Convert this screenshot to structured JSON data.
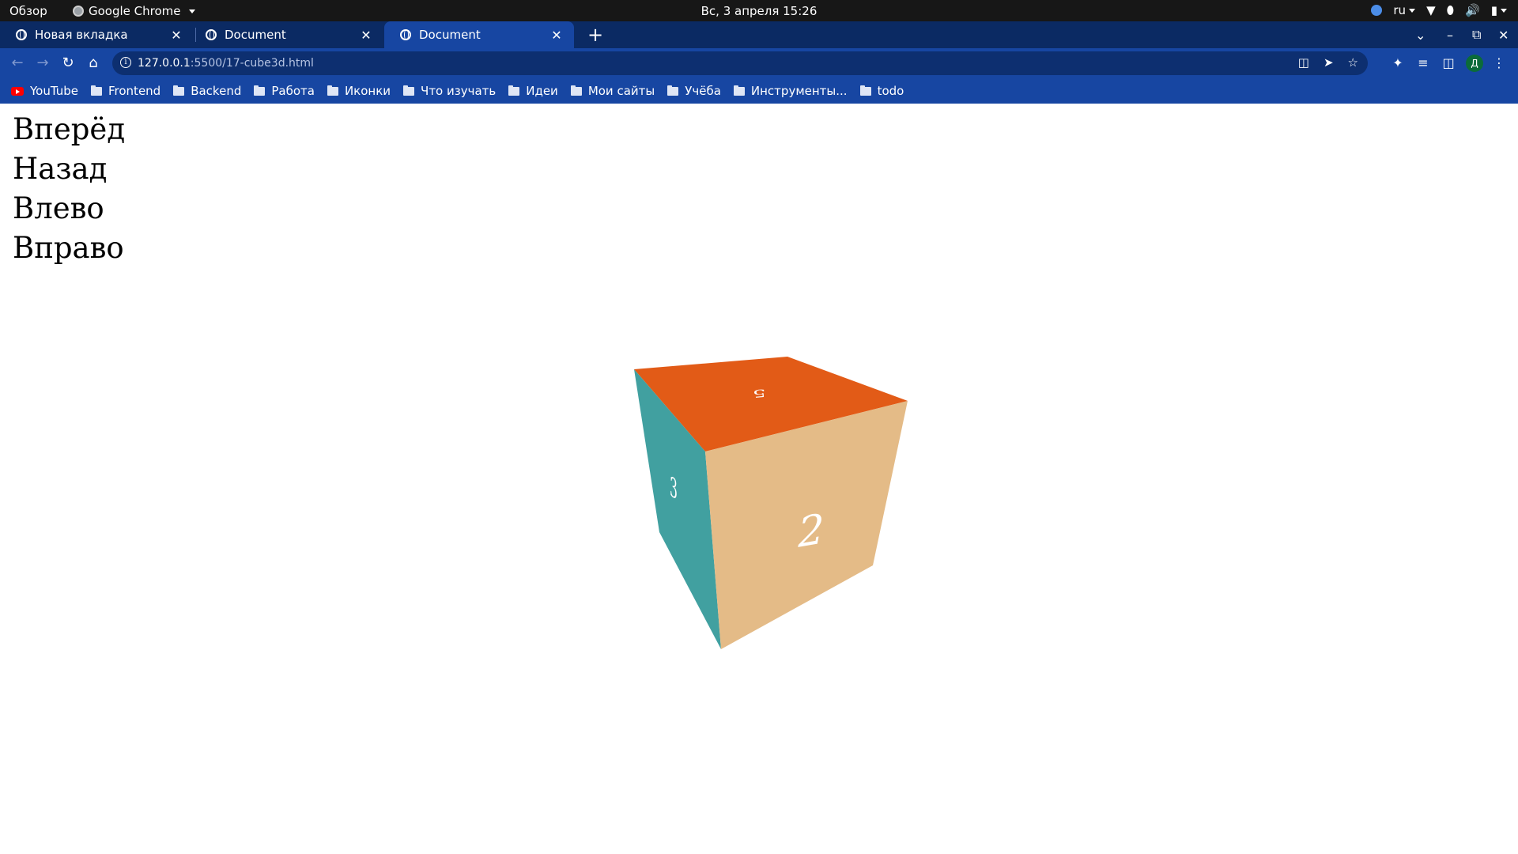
{
  "system_bar": {
    "activities": "Обзор",
    "app_name": "Google Chrome",
    "datetime": "Вс, 3 апреля  15:26",
    "language": "ru"
  },
  "tabs": [
    {
      "title": "Новая вкладка",
      "active": false
    },
    {
      "title": "Document",
      "active": false
    },
    {
      "title": "Document",
      "active": true
    }
  ],
  "address_bar": {
    "host": "127.0.0.1",
    "path": ":5500/17-cube3d.html"
  },
  "profile_initial": "Д",
  "bookmarks": [
    {
      "label": "YouTube",
      "icon": "youtube-icon"
    },
    {
      "label": "Frontend",
      "icon": "folder-icon"
    },
    {
      "label": "Backend",
      "icon": "folder-icon"
    },
    {
      "label": "Работа",
      "icon": "folder-icon"
    },
    {
      "label": "Иконки",
      "icon": "folder-icon"
    },
    {
      "label": "Что изучать",
      "icon": "folder-icon"
    },
    {
      "label": "Идеи",
      "icon": "folder-icon"
    },
    {
      "label": "Мои сайты",
      "icon": "folder-icon"
    },
    {
      "label": "Учёба",
      "icon": "folder-icon"
    },
    {
      "label": "Инструменты...",
      "icon": "folder-icon"
    },
    {
      "label": "todo",
      "icon": "folder-icon"
    }
  ],
  "controls": {
    "forward": "Вперёд",
    "back": "Назад",
    "left": "Влево",
    "right": "Вправо"
  },
  "cube": {
    "top_face": {
      "label": "5",
      "color": "#e25b17"
    },
    "front_face": {
      "label": "2",
      "color": "#e4bb87"
    },
    "left_face": {
      "label": "3",
      "color": "#41a0a0"
    }
  },
  "colors": {
    "topbar": "#171717",
    "tabstrip": "#0b2a63",
    "toolbar": "#1746a2",
    "omnibox": "#0d2f70"
  }
}
